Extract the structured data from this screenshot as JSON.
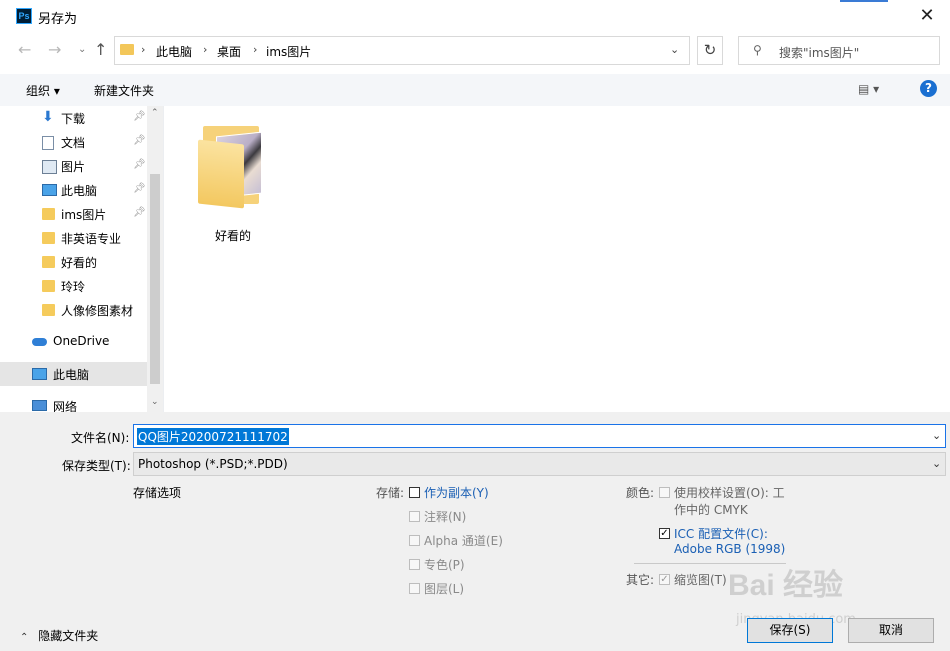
{
  "window": {
    "title": "另存为",
    "app_icon": "Ps",
    "close": "✕"
  },
  "address": {
    "crumbs": [
      "此电脑",
      "桌面",
      "ims图片"
    ],
    "search_placeholder": "搜索\"ims图片\""
  },
  "toolbar": {
    "organize": "组织 ▾",
    "new_folder": "新建文件夹",
    "view": "▤ ▾",
    "help": "?"
  },
  "nav": {
    "quick": [
      {
        "label": "下载",
        "pinned": true
      },
      {
        "label": "文档",
        "pinned": true
      },
      {
        "label": "图片",
        "pinned": true
      },
      {
        "label": "此电脑",
        "pinned": true
      },
      {
        "label": "ims图片",
        "pinned": true
      },
      {
        "label": "非英语专业"
      },
      {
        "label": "好看的"
      },
      {
        "label": "玲玲"
      },
      {
        "label": "人像修图素材"
      }
    ],
    "onedrive": "OneDrive",
    "thispc": "此电脑",
    "network": "网络"
  },
  "content": {
    "items": [
      {
        "name": "好看的"
      }
    ]
  },
  "form": {
    "filename_label": "文件名(N):",
    "filename_value": "QQ图片20200721111702",
    "filetype_label": "保存类型(T):",
    "filetype_value": "Photoshop (*.PSD;*.PDD)",
    "save_options": "存储选项",
    "storage_label": "存储:",
    "as_copy": "作为副本(Y)",
    "notes": "注释(N)",
    "alpha": "Alpha 通道(E)",
    "spot": "专色(P)",
    "layers": "图层(L)",
    "color_label": "颜色:",
    "proof_1": "使用校样设置(O): 工",
    "proof_2": "作中的 CMYK",
    "icc_1": "ICC 配置文件(C):",
    "icc_2": "Adobe RGB (1998)",
    "other_label": "其它:",
    "thumbnail": "缩览图(T)"
  },
  "footer": {
    "hide_folders": "隐藏文件夹",
    "save": "保存(S)",
    "cancel": "取消"
  },
  "watermark": {
    "main": "Bai 经验",
    "sub": "jingyan.baidu.com"
  }
}
